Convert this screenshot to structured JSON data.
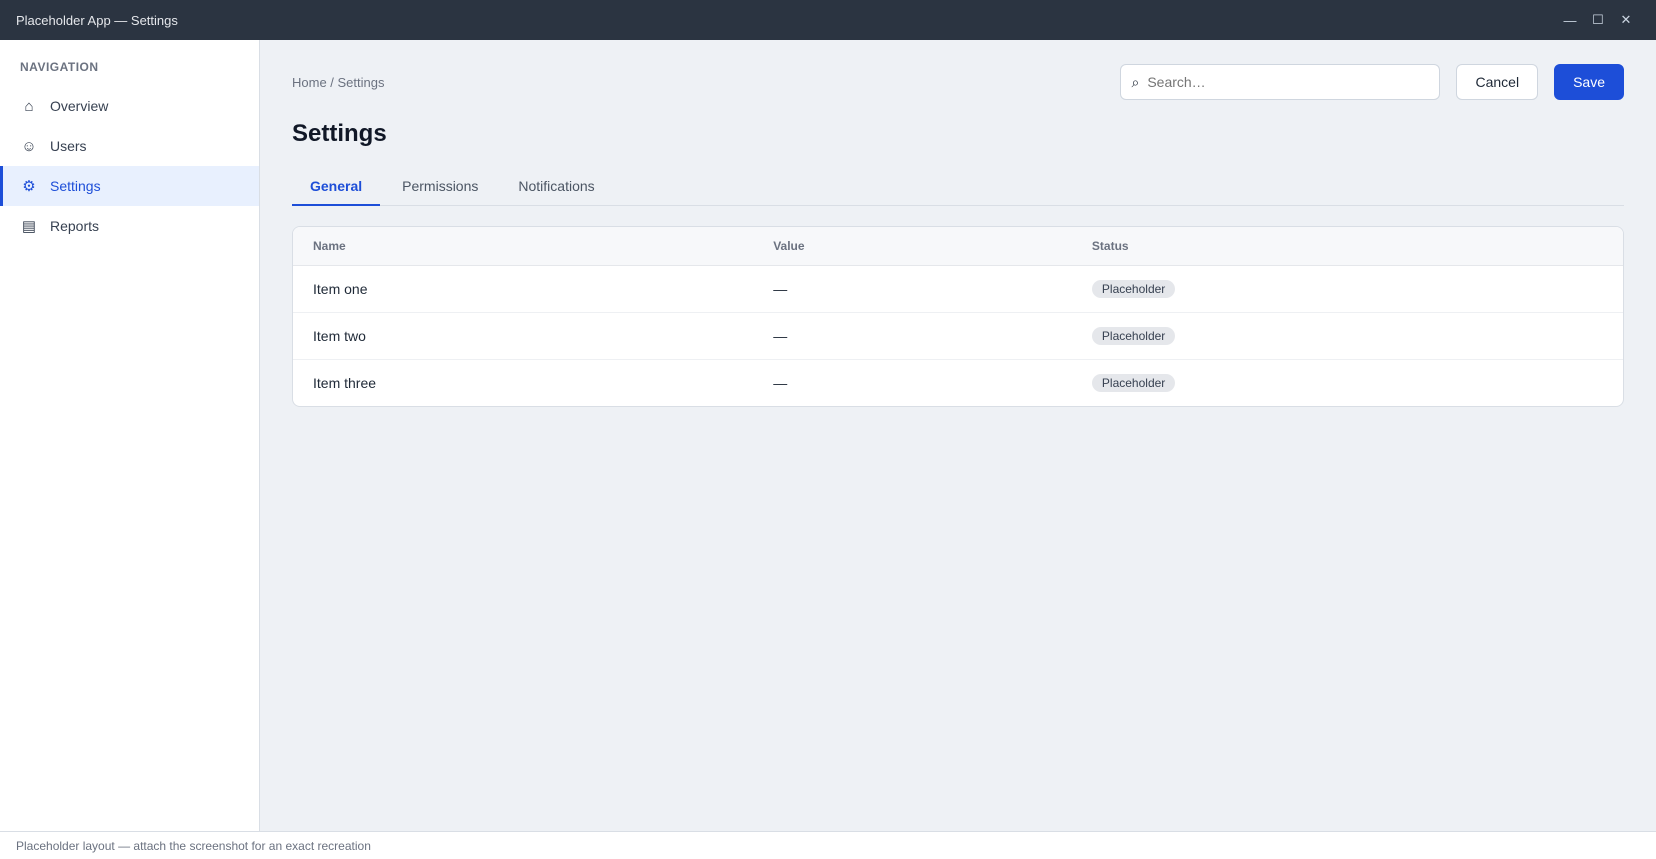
{
  "window": {
    "title": "Placeholder App — Settings",
    "minimize_glyph": "—",
    "maximize_glyph": "☐",
    "close_glyph": "✕"
  },
  "sidebar": {
    "heading": "Navigation",
    "items": [
      {
        "label": "Overview",
        "icon": "home-icon",
        "glyph": "⌂"
      },
      {
        "label": "Users",
        "icon": "users-icon",
        "glyph": "☺"
      },
      {
        "label": "Settings",
        "icon": "gear-icon",
        "glyph": "⚙"
      },
      {
        "label": "Reports",
        "icon": "chart-icon",
        "glyph": "▤"
      }
    ]
  },
  "header": {
    "breadcrumb": "Home / Settings",
    "search_placeholder": "Search…",
    "search_glyph": "⌕",
    "secondary_button": "Cancel",
    "primary_button": "Save"
  },
  "main": {
    "title": "Settings",
    "tabs": [
      "General",
      "Permissions",
      "Notifications"
    ],
    "table": {
      "columns": [
        "Name",
        "Value",
        "Status"
      ],
      "rows": [
        [
          "Item one",
          "—",
          "Placeholder"
        ],
        [
          "Item two",
          "—",
          "Placeholder"
        ],
        [
          "Item three",
          "—",
          "Placeholder"
        ]
      ]
    }
  },
  "statusbar": {
    "text": "Placeholder layout — attach the screenshot for an exact recreation"
  },
  "colors": {
    "accent": "#1d4ed8",
    "titlebar": "#2b3441"
  }
}
